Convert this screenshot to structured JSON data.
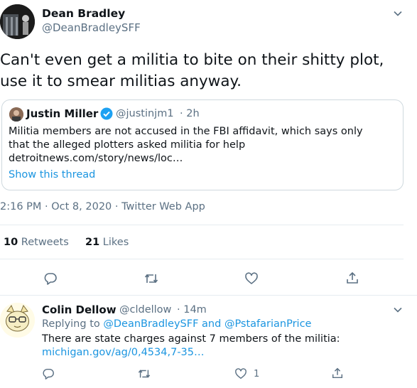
{
  "tweet": {
    "author_name": "Dean Bradley",
    "author_handle": "@DeanBradleySFF",
    "text": "Can't even get a militia to bite on their shitty plot, use it to smear militias anyway.",
    "timestamp": "2:16 PM · Oct 8, 2020 · Twitter Web App",
    "retweets_count": "10",
    "retweets_label": "Retweets",
    "likes_count": "21",
    "likes_label": "Likes",
    "icons": [
      "reply-icon",
      "retweet-icon",
      "like-icon",
      "share-icon",
      "chevron-down-icon"
    ]
  },
  "quoted": {
    "author_name": "Justin Miller",
    "verified": true,
    "author_handle": "@justinjm1",
    "time": "· 2h",
    "text_line1": "Militia members are not accused in the FBI affidavit, which says only",
    "text_line2": "that the alleged plotters asked militia for help",
    "text_line3": "detroitnews.com/story/news/loc…",
    "show_thread": "Show this thread"
  },
  "reply": {
    "author_name": "Colin Dellow",
    "author_handle": "@cldellow",
    "time": "· 14m",
    "replying_prefix": "Replying to",
    "replying_user1": "@DeanBradleySFF",
    "replying_and": "and",
    "replying_user2": "@PstafarianPrice",
    "text": "There are state charges against 7 members of the militia:",
    "link": "michigan.gov/ag/0,4534,7-35…",
    "like_count": "1"
  },
  "colors": {
    "accent": "#1b95e0",
    "muted": "#5b7083",
    "text": "#0f1419",
    "divider": "#e6ecf0",
    "verified": "#1da1f2"
  }
}
